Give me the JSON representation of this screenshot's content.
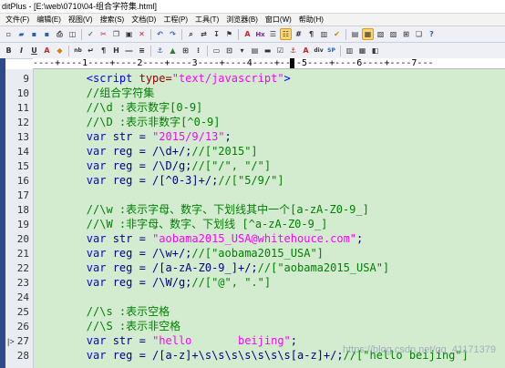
{
  "window": {
    "title": "ditPlus - [E:\\web\\0710\\04-组合字符集.html]"
  },
  "menubar": {
    "items": [
      "文件(F)",
      "编辑(E)",
      "视图(V)",
      "搜索(S)",
      "文档(D)",
      "工程(P)",
      "工具(T)",
      "浏览器(B)",
      "窗口(W)",
      "帮助(H)"
    ]
  },
  "toolbar": {
    "bold_label": "B",
    "italic_label": "I",
    "underline_label": "U",
    "font_label": "A",
    "nb_label": "nb",
    "para_label": "¶",
    "h_label": "H",
    "hx_label": "Hx",
    "div_label": "div",
    "sp_label": "SP",
    "text_label": "A"
  },
  "ruler": {
    "text": "----+----1----+----2----+----3----+----4----+----5----+----6----+----7---"
  },
  "editor": {
    "lines": [
      {
        "num": "9",
        "mark": "",
        "segments": [
          {
            "c": "pl",
            "t": "        "
          },
          {
            "c": "tg",
            "t": "<script "
          },
          {
            "c": "at",
            "t": "type="
          },
          {
            "c": "str",
            "t": "\"text/javascript\""
          },
          {
            "c": "tg",
            "t": ">"
          }
        ]
      },
      {
        "num": "10",
        "mark": "",
        "segments": [
          {
            "c": "pl",
            "t": "        "
          },
          {
            "c": "cm",
            "t": "//组合字符集"
          }
        ]
      },
      {
        "num": "11",
        "mark": "",
        "segments": [
          {
            "c": "pl",
            "t": "        "
          },
          {
            "c": "cm",
            "t": "//\\d :表示数字[0-9]"
          }
        ]
      },
      {
        "num": "12",
        "mark": "",
        "segments": [
          {
            "c": "pl",
            "t": "        "
          },
          {
            "c": "cm",
            "t": "//\\D :表示非数字[^0-9]"
          }
        ]
      },
      {
        "num": "13",
        "mark": "",
        "segments": [
          {
            "c": "pl",
            "t": "        "
          },
          {
            "c": "kw",
            "t": "var"
          },
          {
            "c": "tx",
            "t": " str = "
          },
          {
            "c": "str",
            "t": "\"2015/9/13\""
          },
          {
            "c": "tx",
            "t": ";"
          }
        ]
      },
      {
        "num": "14",
        "mark": "",
        "segments": [
          {
            "c": "pl",
            "t": "        "
          },
          {
            "c": "kw",
            "t": "var"
          },
          {
            "c": "tx",
            "t": " reg = /\\d+/;"
          },
          {
            "c": "cm",
            "t": "//[\"2015\"]"
          }
        ]
      },
      {
        "num": "15",
        "mark": "",
        "segments": [
          {
            "c": "pl",
            "t": "        "
          },
          {
            "c": "kw",
            "t": "var"
          },
          {
            "c": "tx",
            "t": " reg = /\\D/g;"
          },
          {
            "c": "cm",
            "t": "//[\"/\", \"/\"]"
          }
        ]
      },
      {
        "num": "16",
        "mark": "",
        "segments": [
          {
            "c": "pl",
            "t": "        "
          },
          {
            "c": "kw",
            "t": "var"
          },
          {
            "c": "tx",
            "t": " reg = /[^0-3]+/;"
          },
          {
            "c": "cm",
            "t": "//[\"5/9/\"]"
          }
        ]
      },
      {
        "num": "17",
        "mark": "",
        "segments": []
      },
      {
        "num": "18",
        "mark": "",
        "segments": [
          {
            "c": "pl",
            "t": "        "
          },
          {
            "c": "cm",
            "t": "//\\w :表示字母、数字、下划线其中一个[a-zA-Z0-9_]"
          }
        ]
      },
      {
        "num": "19",
        "mark": "",
        "segments": [
          {
            "c": "pl",
            "t": "        "
          },
          {
            "c": "cm",
            "t": "//\\W :非字母、数字、下划线 [^a-zA-Z0-9_]"
          }
        ]
      },
      {
        "num": "20",
        "mark": "",
        "segments": [
          {
            "c": "pl",
            "t": "        "
          },
          {
            "c": "kw",
            "t": "var"
          },
          {
            "c": "tx",
            "t": " str = "
          },
          {
            "c": "str",
            "t": "\"aobama2015_USA@whitehouce.com\""
          },
          {
            "c": "tx",
            "t": ";"
          }
        ]
      },
      {
        "num": "21",
        "mark": "",
        "segments": [
          {
            "c": "pl",
            "t": "        "
          },
          {
            "c": "kw",
            "t": "var"
          },
          {
            "c": "tx",
            "t": " reg = /\\w+/;"
          },
          {
            "c": "cm",
            "t": "//[\"aobama2015_USA\"]"
          }
        ]
      },
      {
        "num": "22",
        "mark": "",
        "segments": [
          {
            "c": "pl",
            "t": "        "
          },
          {
            "c": "kw",
            "t": "var"
          },
          {
            "c": "tx",
            "t": " reg = /[a-zA-Z0-9_]+/;"
          },
          {
            "c": "cm",
            "t": "//[\"aobama2015_USA\"]"
          }
        ]
      },
      {
        "num": "23",
        "mark": "",
        "segments": [
          {
            "c": "pl",
            "t": "        "
          },
          {
            "c": "kw",
            "t": "var"
          },
          {
            "c": "tx",
            "t": " reg = /\\W/g;"
          },
          {
            "c": "cm",
            "t": "//[\"@\", \".\"]"
          }
        ]
      },
      {
        "num": "24",
        "mark": "",
        "segments": []
      },
      {
        "num": "25",
        "mark": "",
        "segments": [
          {
            "c": "pl",
            "t": "        "
          },
          {
            "c": "cm",
            "t": "//\\s :表示空格"
          }
        ]
      },
      {
        "num": "26",
        "mark": "",
        "segments": [
          {
            "c": "pl",
            "t": "        "
          },
          {
            "c": "cm",
            "t": "//\\S :表示非空格"
          }
        ]
      },
      {
        "num": "27",
        "mark": "|>",
        "segments": [
          {
            "c": "pl",
            "t": "        "
          },
          {
            "c": "kw",
            "t": "var"
          },
          {
            "c": "tx",
            "t": " str = "
          },
          {
            "c": "str",
            "t": "\"hello       beijing\""
          },
          {
            "c": "tx",
            "t": ";"
          }
        ]
      },
      {
        "num": "28",
        "mark": "",
        "segments": [
          {
            "c": "pl",
            "t": "        "
          },
          {
            "c": "kw",
            "t": "var"
          },
          {
            "c": "tx",
            "t": " reg = /[a-z]+\\s\\s\\s\\s\\s\\s\\s[a-z]+/;"
          },
          {
            "c": "cm",
            "t": "//[\"hello beijing\"]"
          }
        ]
      }
    ]
  },
  "watermark": {
    "text": "https://blog.csdn.net/qq_41171379"
  }
}
